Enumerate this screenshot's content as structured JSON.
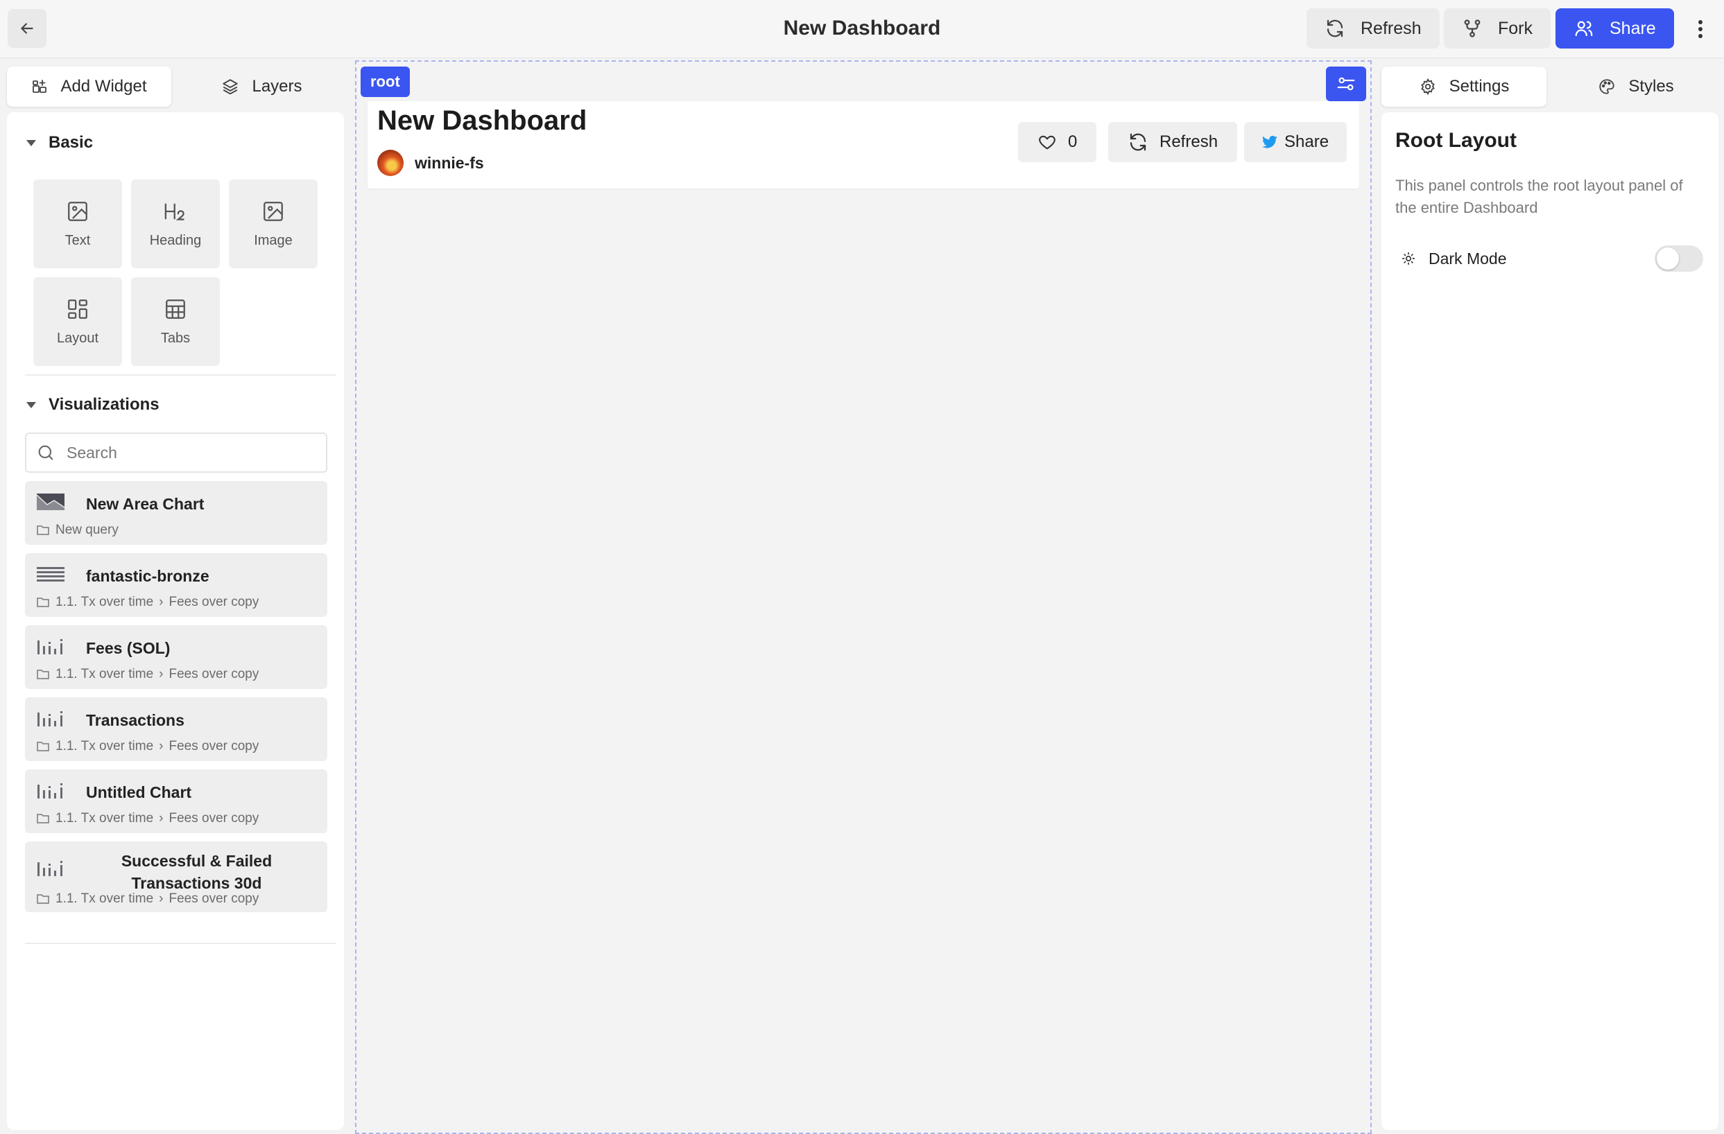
{
  "header": {
    "title": "New Dashboard",
    "refresh_label": "Refresh",
    "fork_label": "Fork",
    "share_label": "Share"
  },
  "left_panel": {
    "tabs": [
      {
        "label": "Add Widget",
        "icon": "add-widget-icon",
        "active": true
      },
      {
        "label": "Layers",
        "icon": "layers-icon",
        "active": false
      }
    ],
    "basic": {
      "title": "Basic",
      "tiles": [
        {
          "label": "Text",
          "icon": "image-icon"
        },
        {
          "label": "Heading",
          "icon": "heading-icon"
        },
        {
          "label": "Image",
          "icon": "image-icon"
        },
        {
          "label": "Layout",
          "icon": "layout-icon"
        },
        {
          "label": "Tabs",
          "icon": "table-icon"
        }
      ]
    },
    "visualizations": {
      "title": "Visualizations",
      "search_placeholder": "Search",
      "items": [
        {
          "title": "New Area Chart",
          "icon": "area-chart-icon",
          "path": [
            "New query"
          ]
        },
        {
          "title": "fantastic-bronze",
          "icon": "table-lines-icon",
          "path": [
            "1.1. Tx over time",
            "Fees over copy"
          ]
        },
        {
          "title": "Fees (SOL)",
          "icon": "bar-chart-icon",
          "path": [
            "1.1. Tx over time",
            "Fees over copy"
          ]
        },
        {
          "title": "Transactions",
          "icon": "bar-chart-icon",
          "path": [
            "1.1. Tx over time",
            "Fees over copy"
          ]
        },
        {
          "title": "Untitled Chart",
          "icon": "bar-chart-icon",
          "path": [
            "1.1. Tx over time",
            "Fees over copy"
          ]
        },
        {
          "title": "Successful & Failed Transactions 30d",
          "icon": "bar-chart-icon",
          "path": [
            "1.1. Tx over time",
            "Fees over copy"
          ]
        }
      ]
    }
  },
  "canvas": {
    "root_tag": "root",
    "dashboard": {
      "title": "New Dashboard",
      "author": "winnie-fs",
      "likes": "0",
      "refresh_label": "Refresh",
      "share_label": "Share"
    }
  },
  "right_panel": {
    "tabs": [
      {
        "label": "Settings",
        "icon": "gear-icon",
        "active": true
      },
      {
        "label": "Styles",
        "icon": "palette-icon",
        "active": false
      }
    ],
    "title": "Root Layout",
    "description": "This panel controls the root layout panel of the entire Dashboard",
    "dark_mode_label": "Dark Mode",
    "dark_mode_enabled": false
  },
  "colors": {
    "accent": "#3a55f0",
    "twitter": "#1d9bf0"
  }
}
